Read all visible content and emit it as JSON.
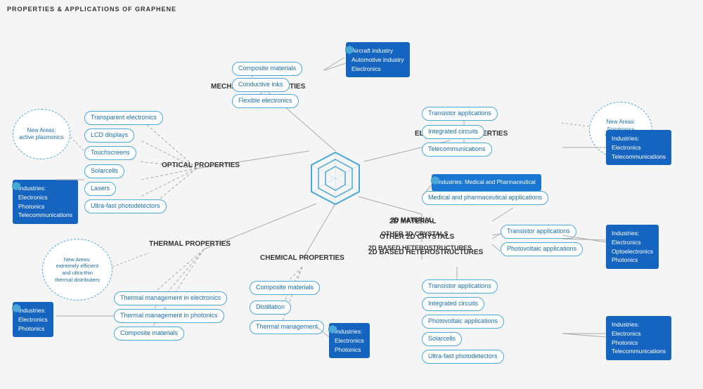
{
  "title": "PROPERTIES & APPLICATIONS OF GRAPHENE",
  "categories": {
    "mechanical": "MECHANICAL PROPERTIES",
    "optical": "OPTICAL PROPERTIES",
    "electronic": "ELECTRONIC PROPERTIES",
    "thermal": "THERMAL PROPERTIES",
    "chemical": "CHEMICAL PROPERTIES",
    "twoD": "2D MATERIAL",
    "other2D": "OTHER 2D CRYSTALS",
    "twoDHetero": "2D BASED HETEROSTRUCTURES"
  },
  "pills": {
    "composite1": "Composite materials",
    "conductiveInks": "Conductive inks",
    "flexibleElec": "Flexible electronics",
    "transparentElec": "Transparent electronics",
    "lcd": "LCD displays",
    "touchscreens": "Touchscreens",
    "solarcells1": "Solarcells",
    "lasers": "Lasers",
    "ultrafast1": "Ultra-fast photodetectors",
    "transistor1": "Transistor applications",
    "integratedCircuits1": "Integrated circuits",
    "telecom1": "Telecommunications",
    "medPharm": "Medical and pharmaceutical applications",
    "transistor2": "Transistor applications",
    "photovoltaic1": "Photovoltaic applications",
    "transistor3": "Transistor applications",
    "integratedCircuits2": "Integrated circuits",
    "photovoltaic2": "Photovoltaic applications",
    "solarcells2": "Solarcells",
    "ultrafast2": "Ultra-fast photodetectors",
    "thermal1": "Thermal management in electronics",
    "thermal2": "Thermal management in photonics",
    "composite2": "Composite materials",
    "composite3": "Composite materials",
    "distillation": "Distillation",
    "thermalMgmt": "Thermal management"
  },
  "blueBoxes": {
    "aircraft": "Aircraft industry\nAutomotive industry\nElectronics",
    "spintronics": "New Areas:\nSpintronics\nValleytronics",
    "elecTelecom": "Industries:\nElectronics\nTelecommunications",
    "medPharmInd": "Industries: Medical and Pharmaceutical",
    "elecOptoPhoton": "Industries:\nElectronics\nOptoelectronics\nPhotonics",
    "elecPhoton1": "Industries:\nElectronics\nPhotonics",
    "elecPhoton2": "Industries:\nElectronics\nPhotonics\nTelecommunications",
    "elecPhoton3": "Industries:\nElectronics\nPhotonics",
    "activePlasmonics": "New Areas:\nactive plasmonics",
    "industElecPhotonTelecom": "Industries:\nElectronics\nPhotonics\nTelecommunications",
    "thermalNew": "New Areas:\nextremely efficient\nand ultra-thin\nthermal distributers",
    "chemIndustries": "Industries:\nElectronics\nPhotonics"
  }
}
